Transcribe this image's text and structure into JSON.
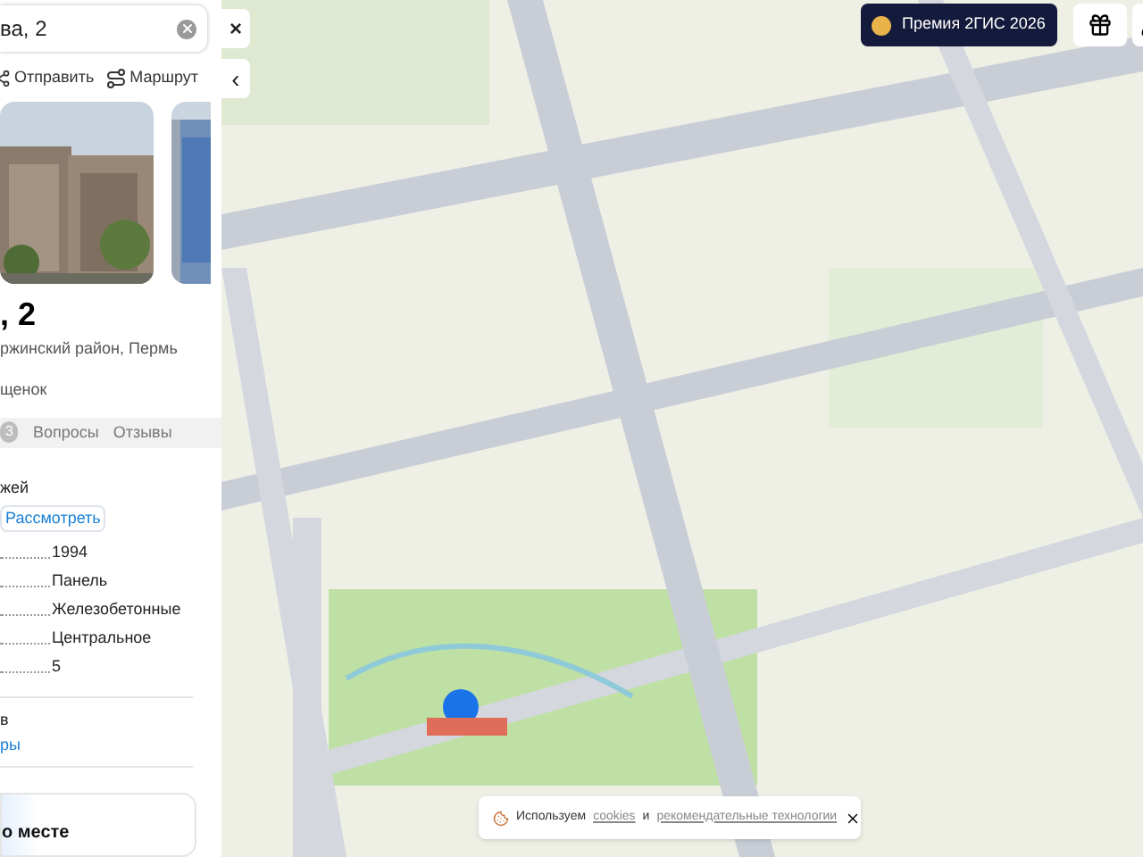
{
  "sidebar": {
    "search": {
      "value": "ва, 2"
    },
    "actions": [
      {
        "kind": "share",
        "label": "Отправить"
      },
      {
        "kind": "route",
        "label": "Маршрут"
      }
    ],
    "title": ", 2",
    "address": "ржинский район, Пермь",
    "rating_text": "щенок",
    "tabs": [
      {
        "badge": "3",
        "selected": false
      },
      {
        "label": "Вопросы",
        "selected": false
      },
      {
        "label": "Отзывы",
        "selected": false
      }
    ],
    "floors_label": "жей",
    "consider_button": "Рассмотреть",
    "specs": [
      {
        "value": "1994"
      },
      {
        "value": "Панель"
      },
      {
        "value": "Железобетонные"
      },
      {
        "value": "Центральное"
      },
      {
        "value": "5"
      }
    ],
    "extra_text": "в",
    "extra_link": "ры",
    "card_title": "о месте"
  },
  "map": {
    "close_button": "×",
    "collapse_button": "‹",
    "premium_button": "Премия 2ГИС 2026",
    "cookie_banner": {
      "prefix": "Используем",
      "link_1": "cookies",
      "middle": "и",
      "link_2": "рекомендательные технологии"
    }
  }
}
